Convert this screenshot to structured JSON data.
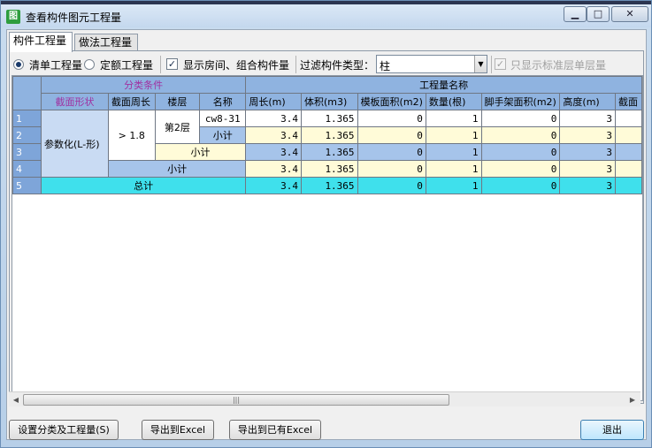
{
  "window": {
    "title": "查看构件图元工程量",
    "app_icon": "图",
    "min_glyph": "▁",
    "max_glyph": "□",
    "close_glyph": "✕"
  },
  "tabs": [
    {
      "label": "构件工程量",
      "active": true
    },
    {
      "label": "做法工程量",
      "active": false
    }
  ],
  "options": {
    "radio_list": "清单工程量",
    "radio_quota": "定额工程量",
    "show_rooms_label": "显示房间、组合构件量",
    "filter_label": "过滤构件类型：",
    "filter_value": "柱",
    "std_floor_only_label": "只显示标准层单层量",
    "check_glyph": "✓"
  },
  "table": {
    "group_header_category": "分类条件",
    "group_header_quantity": "工程量名称",
    "columns": [
      "截面形状",
      "截面周长",
      "楼层",
      "名称",
      "周长(m)",
      "体积(m3)",
      "模板面积(m2)",
      "数量(根)",
      "脚手架面积(m2)",
      "高度(m)",
      "截面"
    ],
    "rows": [
      {
        "num": "1",
        "values": [
          "3.4",
          "1.365",
          "0",
          "1",
          "0",
          "3"
        ]
      },
      {
        "num": "2",
        "values": [
          "3.4",
          "1.365",
          "0",
          "1",
          "0",
          "3"
        ]
      },
      {
        "num": "3",
        "values": [
          "3.4",
          "1.365",
          "0",
          "1",
          "0",
          "3"
        ]
      },
      {
        "num": "4",
        "values": [
          "3.4",
          "1.365",
          "0",
          "1",
          "0",
          "3"
        ]
      },
      {
        "num": "5",
        "values": [
          "3.4",
          "1.365",
          "0",
          "1",
          "0",
          "3"
        ]
      }
    ],
    "shape_value": "参数化(L-形)",
    "perimeter_value": "> 1.8",
    "floor_value": "第2层",
    "name_value": "cw8-31",
    "subtotal": "小计",
    "total": "总计"
  },
  "scrollbar": {
    "left_arrow": "◀",
    "right_arrow": "▶",
    "grip": "|||"
  },
  "buttons": {
    "settings": "设置分类及工程量(S)",
    "export_excel": "导出到Excel",
    "export_existing_excel": "导出到已有Excel",
    "exit": "退出"
  }
}
